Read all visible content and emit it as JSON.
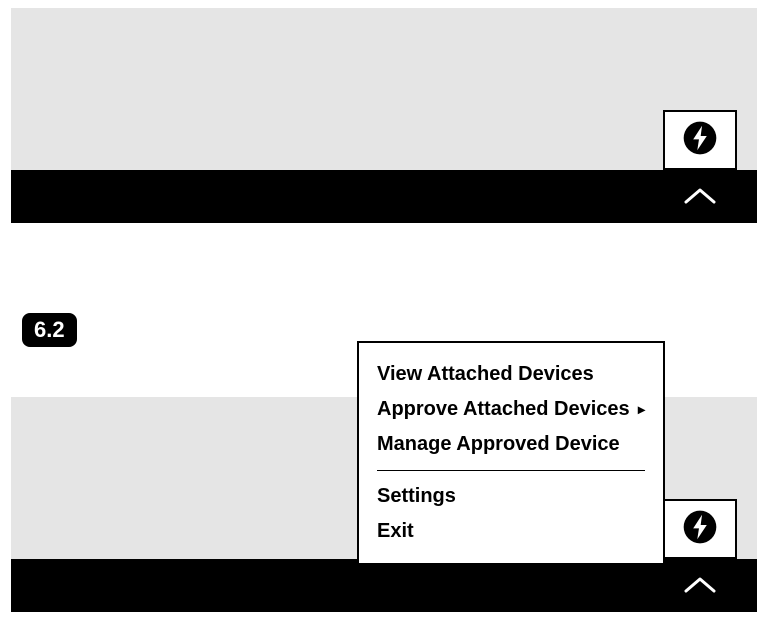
{
  "step_label": "6.2",
  "icons": {
    "tray": "thunderbolt-icon",
    "expand": "chevron-up-icon"
  },
  "menu": {
    "items": [
      {
        "label": "View Attached Devices",
        "has_submenu": false
      },
      {
        "label": "Approve Attached Devices",
        "has_submenu": true
      },
      {
        "label": "Manage Approved Device",
        "has_submenu": false
      }
    ],
    "items2": [
      {
        "label": "Settings",
        "has_submenu": false
      },
      {
        "label": "Exit",
        "has_submenu": false
      }
    ]
  }
}
